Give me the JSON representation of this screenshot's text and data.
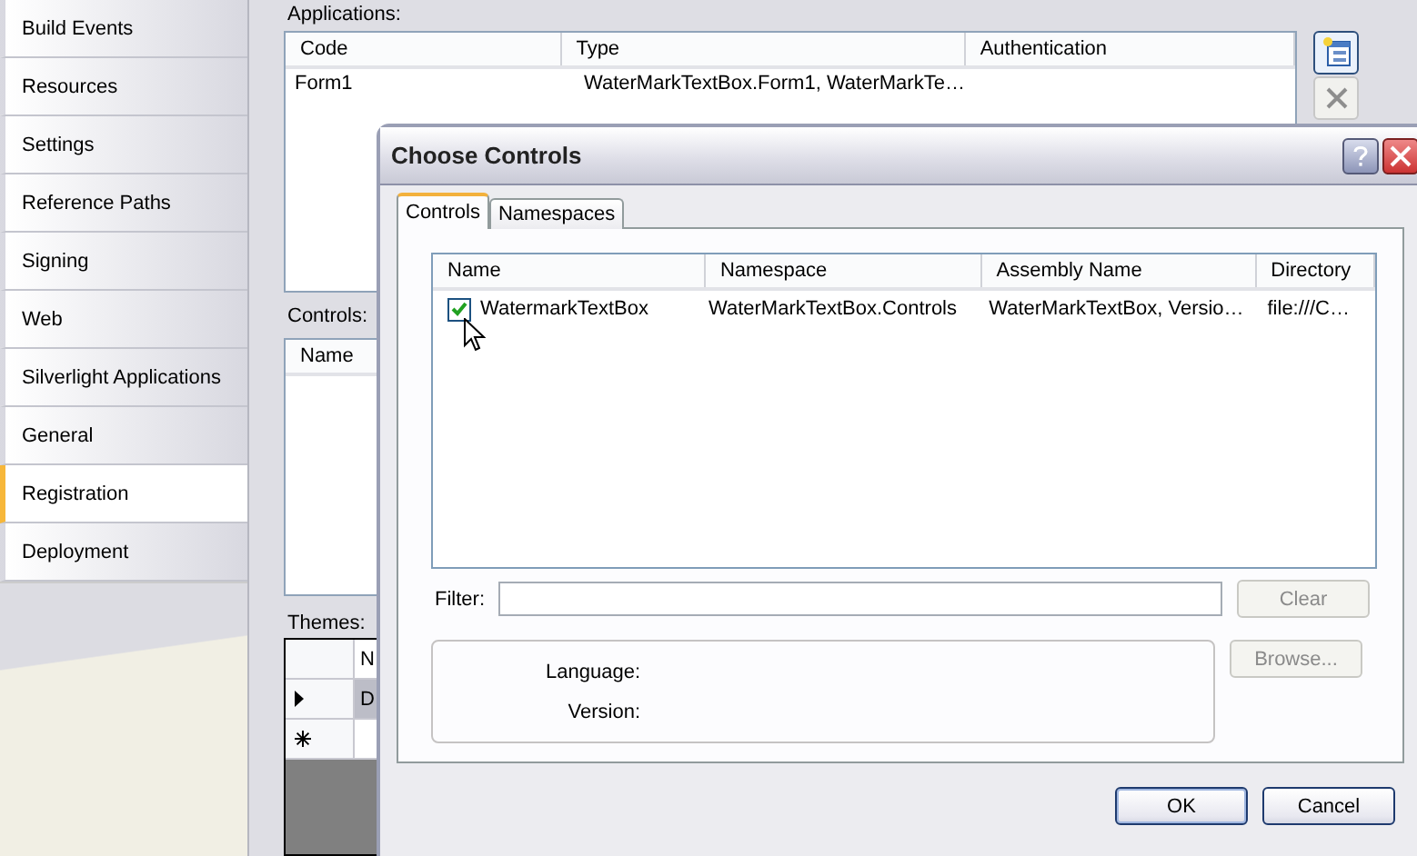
{
  "sidebar": {
    "items": [
      {
        "label": "Build Events",
        "selected": false
      },
      {
        "label": "Resources",
        "selected": false
      },
      {
        "label": "Settings",
        "selected": false
      },
      {
        "label": "Reference Paths",
        "selected": false
      },
      {
        "label": "Signing",
        "selected": false
      },
      {
        "label": "Web",
        "selected": false
      },
      {
        "label": "Silverlight Applications",
        "selected": false
      },
      {
        "label": "General",
        "selected": false
      },
      {
        "label": "Registration",
        "selected": true
      },
      {
        "label": "Deployment",
        "selected": false
      }
    ]
  },
  "applications": {
    "label": "Applications:",
    "columns": [
      "Code",
      "Type",
      "Authentication"
    ],
    "rows": [
      [
        "Form1",
        "WaterMarkTextBox.Form1, WaterMarkTe…",
        ""
      ]
    ]
  },
  "controls": {
    "label": "Controls:",
    "columns": [
      "Name"
    ]
  },
  "themes": {
    "label": "Themes:",
    "column": "N",
    "rows": [
      {
        "kind": "current",
        "cell": "D"
      },
      {
        "kind": "new",
        "cell": ""
      }
    ]
  },
  "dialog": {
    "title": "Choose Controls",
    "tabs": [
      {
        "label": "Controls",
        "selected": true
      },
      {
        "label": "Namespaces",
        "selected": false
      }
    ],
    "list": {
      "columns": [
        "Name",
        "Namespace",
        "Assembly Name",
        "Directory"
      ],
      "rows": [
        {
          "checked": true,
          "cells": [
            "WatermarkTextBox",
            "WaterMarkTextBox.Controls",
            "WaterMarkTextBox, Versio…",
            "file:///C…"
          ]
        }
      ]
    },
    "filter_label": "Filter:",
    "clear_button": {
      "label": "Clear",
      "disabled": true
    },
    "info_labels": [
      "Language:",
      "Version:"
    ],
    "browse_button": {
      "label": "Browse...",
      "disabled": true
    },
    "buttons": [
      {
        "label": "OK",
        "default": true
      },
      {
        "label": "Cancel",
        "default": false
      }
    ]
  }
}
